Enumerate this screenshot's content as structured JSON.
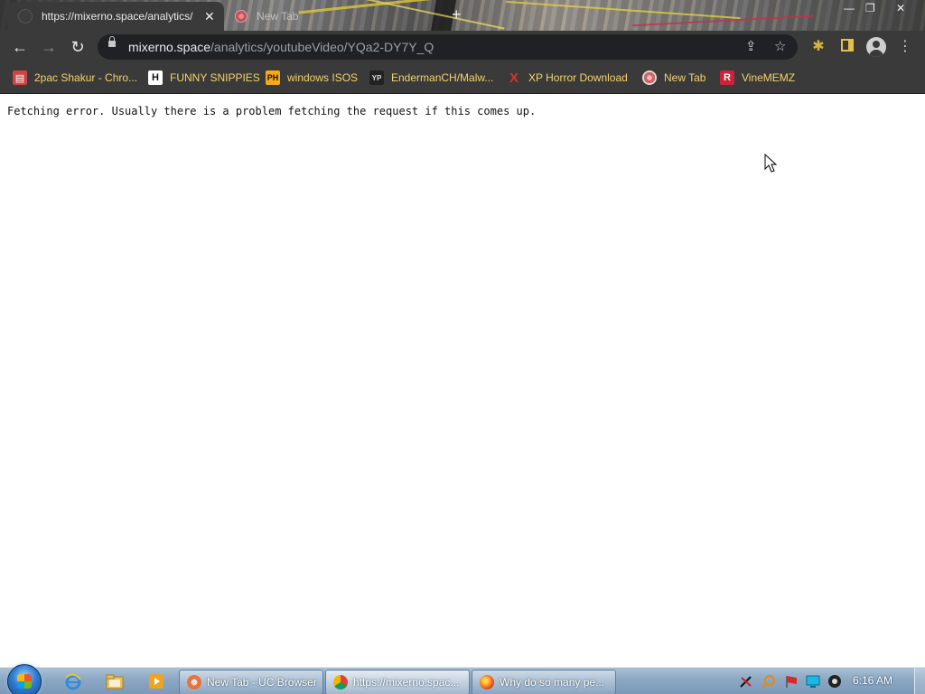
{
  "browser": {
    "tabs": [
      {
        "title": "https://mixerno.space/analytics/",
        "active": true
      },
      {
        "title": "New Tab",
        "active": false
      }
    ],
    "new_tab_label": "+",
    "address": {
      "host": "mixerno.space",
      "path": "/analytics/youtubeVideo/YQa2-DY7Y_Q"
    },
    "bookmarks": [
      {
        "label": "2pac Shakur - Chro...",
        "icon": "bookmark-favicon-2pac"
      },
      {
        "label": "FUNNY SNIPPIES",
        "icon": "bookmark-favicon-h"
      },
      {
        "label": "windows ISOS",
        "icon": "bookmark-favicon-ph"
      },
      {
        "label": "EndermanCH/Malw...",
        "icon": "bookmark-favicon-yp"
      },
      {
        "label": "XP Horror Download",
        "icon": "bookmark-favicon-x"
      },
      {
        "label": "New Tab",
        "icon": "bookmark-favicon-newtab"
      },
      {
        "label": "VineMEMZ",
        "icon": "bookmark-favicon-r"
      }
    ]
  },
  "page": {
    "message": "Fetching error. Usually there is a problem fetching the request if this comes up."
  },
  "taskbar": {
    "buttons": [
      {
        "label": "New Tab - UC Browser",
        "icon": "uc-browser-icon"
      },
      {
        "label": "https://mixerno.spac...",
        "icon": "chrome-icon",
        "active": true
      },
      {
        "label": "Why do so many pe...",
        "icon": "firefox-icon"
      }
    ],
    "clock": "6:16 AM"
  },
  "colors": {
    "chrome_dark": "#3a3a3a",
    "omnibox": "#202124",
    "bookmark_text": "#f3d36b",
    "page_bg": "#ffffff",
    "taskbar": "#8ba7c3"
  }
}
